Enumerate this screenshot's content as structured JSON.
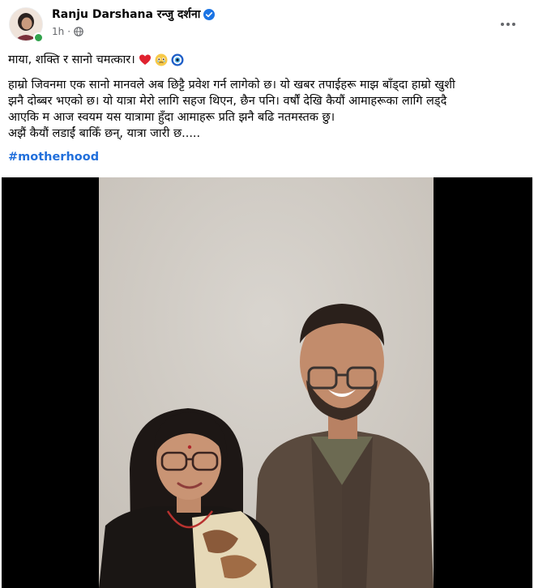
{
  "post": {
    "author_name": "Ranju Darshana रन्जु दर्शना",
    "timestamp": "1h",
    "separator": "·",
    "privacy_icon": "globe-icon",
    "verified_icon": "verified-badge-icon",
    "more_icon": "more-horizontal-icon",
    "title_line": "माया, शक्ति र सानो चमत्कार।",
    "title_emojis": [
      "red-heart-emoji",
      "holding-back-tears-emoji",
      "nazar-amulet-emoji"
    ],
    "body_lines": [
      "हाम्रो जिवनमा एक सानो मानवले अब छिट्टै प्रवेश गर्न लागेको छ। यो खबर तपाईहरू माझ बाँड्दा हाम्रो खुशी",
      "झनै दोब्बर भएको छ। यो यात्रा मेरो लागि सहज थिएन, छैन पनि। वर्षौं देखि कैयौं आमाहरूका लागि लड्दै",
      "आएकि म आज स्वयम यस यात्रामा हुँदा आमाहरू प्रति झनै बढि नतमस्तक छु।",
      "अझैं कैयौं लडाईं बाकिँ छन्, यात्रा जारी छ....."
    ],
    "hashtag": "#motherhood"
  },
  "colors": {
    "link": "#216fdb",
    "meta": "#65676b",
    "verified": "#1b74e4",
    "online": "#31a24c"
  }
}
